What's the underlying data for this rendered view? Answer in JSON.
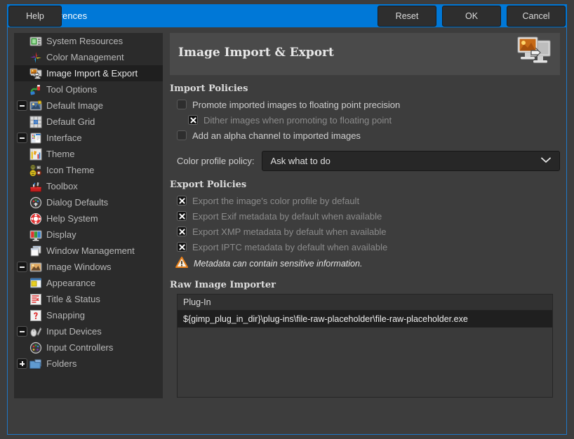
{
  "window": {
    "title": "Preferences",
    "icon": "wilber-icon",
    "close_label": "✕",
    "titlebar_color": "#0078d7"
  },
  "sidebar": {
    "items": [
      {
        "label": "System Resources",
        "icon": "system-resources-icon",
        "level": 0,
        "expander": "none",
        "selected": false
      },
      {
        "label": "Color Management",
        "icon": "color-management-icon",
        "level": 0,
        "expander": "none",
        "selected": false
      },
      {
        "label": "Image Import & Export",
        "icon": "image-import-export-icon",
        "level": 0,
        "expander": "none",
        "selected": true
      },
      {
        "label": "Tool Options",
        "icon": "tool-options-icon",
        "level": 0,
        "expander": "none",
        "selected": false
      },
      {
        "label": "Default Image",
        "icon": "default-image-icon",
        "level": 0,
        "expander": "minus",
        "selected": false
      },
      {
        "label": "Default Grid",
        "icon": "default-grid-icon",
        "level": 1,
        "expander": "none",
        "selected": false
      },
      {
        "label": "Interface",
        "icon": "interface-icon",
        "level": 0,
        "expander": "minus",
        "selected": false
      },
      {
        "label": "Theme",
        "icon": "theme-icon",
        "level": 1,
        "expander": "none",
        "selected": false
      },
      {
        "label": "Icon Theme",
        "icon": "icon-theme-icon",
        "level": 1,
        "expander": "none",
        "selected": false
      },
      {
        "label": "Toolbox",
        "icon": "toolbox-icon",
        "level": 1,
        "expander": "none",
        "selected": false
      },
      {
        "label": "Dialog Defaults",
        "icon": "dialog-defaults-icon",
        "level": 1,
        "expander": "none",
        "selected": false
      },
      {
        "label": "Help System",
        "icon": "help-system-icon",
        "level": 1,
        "expander": "none",
        "selected": false
      },
      {
        "label": "Display",
        "icon": "display-icon",
        "level": 1,
        "expander": "none",
        "selected": false
      },
      {
        "label": "Window Management",
        "icon": "window-management-icon",
        "level": 1,
        "expander": "none",
        "selected": false
      },
      {
        "label": "Image Windows",
        "icon": "image-windows-icon",
        "level": 0,
        "expander": "minus",
        "selected": false
      },
      {
        "label": "Appearance",
        "icon": "appearance-icon",
        "level": 1,
        "expander": "none",
        "selected": false
      },
      {
        "label": "Title & Status",
        "icon": "title-status-icon",
        "level": 1,
        "expander": "none",
        "selected": false
      },
      {
        "label": "Snapping",
        "icon": "snapping-icon",
        "level": 1,
        "expander": "none",
        "selected": false
      },
      {
        "label": "Input Devices",
        "icon": "input-devices-icon",
        "level": 0,
        "expander": "minus",
        "selected": false
      },
      {
        "label": "Input Controllers",
        "icon": "input-controllers-icon",
        "level": 1,
        "expander": "none",
        "selected": false
      },
      {
        "label": "Folders",
        "icon": "folders-icon",
        "level": 0,
        "expander": "plus",
        "selected": false
      }
    ]
  },
  "main": {
    "page_title": "Image Import & Export",
    "header_icon": "image-import-export-large-icon",
    "import_policies": {
      "title": "Import Policies",
      "options": [
        {
          "label": "Promote imported images to floating point precision",
          "checked": false,
          "dim": false,
          "indent": 0
        },
        {
          "label": "Dither images when promoting to floating point",
          "checked": true,
          "dim": true,
          "indent": 1
        },
        {
          "label": "Add an alpha channel to imported images",
          "checked": false,
          "dim": false,
          "indent": 0
        }
      ],
      "color_profile_policy": {
        "label": "Color profile policy:",
        "value": "Ask what to do"
      }
    },
    "export_policies": {
      "title": "Export Policies",
      "options": [
        {
          "label": "Export the image's color profile by default",
          "checked": true,
          "dim": true
        },
        {
          "label": "Export Exif metadata by default when available",
          "checked": true,
          "dim": true
        },
        {
          "label": "Export XMP metadata by default when available",
          "checked": true,
          "dim": true
        },
        {
          "label": "Export IPTC metadata by default when available",
          "checked": true,
          "dim": true
        }
      ],
      "warning": {
        "icon": "warning-triangle-icon",
        "text": "Metadata can contain sensitive information."
      }
    },
    "raw_image_importer": {
      "title": "Raw Image Importer",
      "column_header": "Plug-In",
      "rows": [
        {
          "value": "${gimp_plug_in_dir}\\plug-ins\\file-raw-placeholder\\file-raw-placeholder.exe",
          "selected": true
        }
      ]
    }
  },
  "footer": {
    "help_label": "Help",
    "reset_label": "Reset",
    "ok_label": "OK",
    "cancel_label": "Cancel"
  }
}
